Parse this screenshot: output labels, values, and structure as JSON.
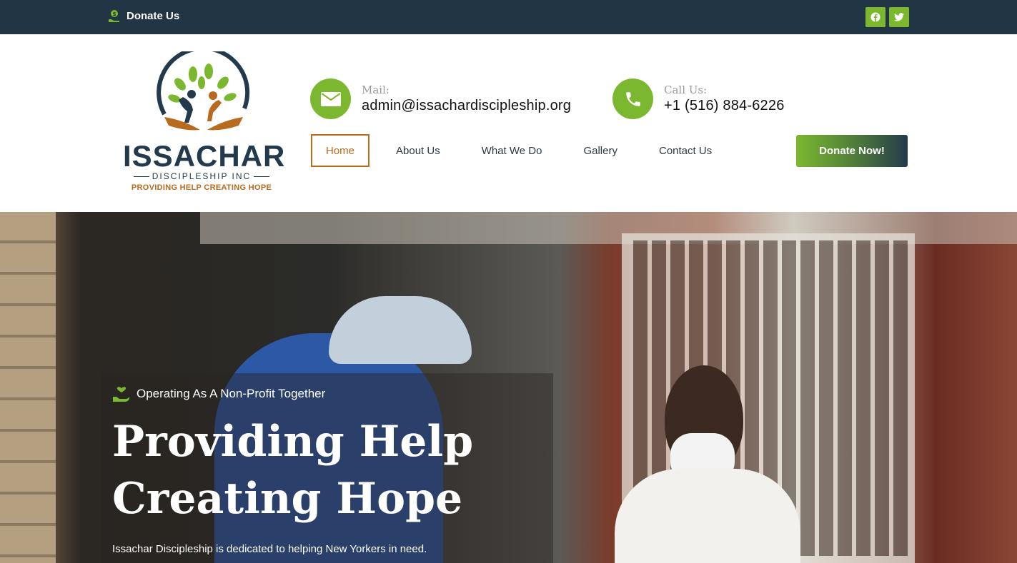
{
  "topbar": {
    "donate_label": "Donate Us",
    "social": [
      "facebook-icon",
      "twitter-icon"
    ]
  },
  "header": {
    "logo": {
      "name": "ISSACHAR",
      "sub": "DISCIPLESHIP INC",
      "tagline": "PROVIDING HELP CREATING HOPE"
    },
    "mail": {
      "label": "Mail:",
      "value": "admin@issachardiscipleship.org"
    },
    "call": {
      "label": "Call Us:",
      "value": "+1 (516) 884-6226"
    },
    "nav": [
      "Home",
      "About Us",
      "What We Do",
      "Gallery",
      "Contact Us"
    ],
    "active_nav": "Home",
    "donate_button": "Donate Now!"
  },
  "hero": {
    "eyebrow": "Operating As A Non-Profit Together",
    "title_line1": "Providing Help",
    "title_line2": "Creating Hope",
    "description": "Issachar Discipleship is dedicated to helping New Yorkers in need."
  },
  "colors": {
    "topbar": "#213545",
    "accent_green": "#7cb82f",
    "accent_orange": "#b86a1e",
    "navy": "#233a4c"
  }
}
